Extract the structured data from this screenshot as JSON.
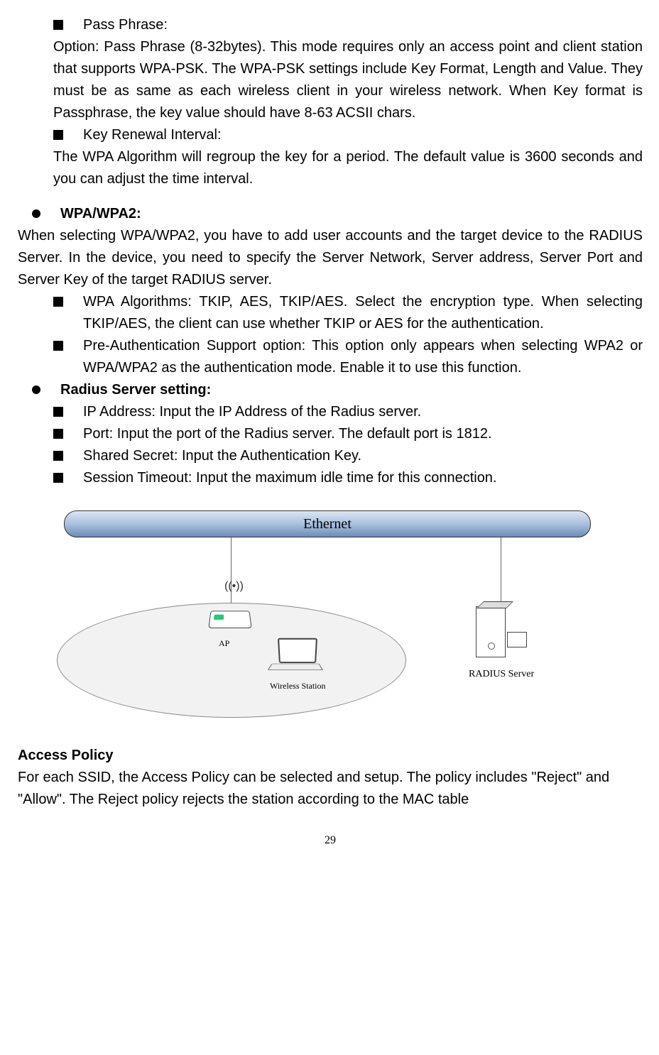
{
  "items": {
    "pass_phrase_title": "Pass Phrase:",
    "pass_phrase_body": "Option: Pass Phrase (8-32bytes). This mode requires only an access point and client station that supports WPA-PSK. The WPA-PSK settings include Key Format, Length and Value. They must be as same as each wireless client in your wireless network. When Key format is Passphrase, the key value should have 8-63 ACSII chars.",
    "key_renewal_title": "Key Renewal Interval:",
    "key_renewal_body": "The WPA Algorithm will regroup the key for a period. The default value is 3600 seconds and you can adjust the time interval.",
    "wpa_wpa2_title": "WPA/WPA2:",
    "wpa_wpa2_body": "When selecting WPA/WPA2, you have to add user accounts and the target device to the RADIUS Server. In the device, you need to specify the Server Network, Server address, Server Port and Server Key of the target RADIUS server.",
    "wpa_algo": "WPA Algorithms: TKIP, AES, TKIP/AES. Select the encryption type. When selecting TKIP/AES, the client can use whether TKIP or AES for the authentication.",
    "preauth": "Pre-Authentication Support option: This option only appears when selecting WPA2 or WPA/WPA2 as the authentication mode. Enable it to use this function.",
    "radius_title": "Radius Server setting:",
    "ip_addr": "IP Address: Input the IP Address of the Radius server.",
    "port": "Port: Input the port of the Radius server. The default port is 1812.",
    "shared_secret": "Shared Secret: Input the Authentication Key.",
    "session_timeout": "Session Timeout: Input the maximum idle time for this connection."
  },
  "diagram": {
    "ethernet": "Ethernet",
    "ap": "AP",
    "wireless_station": "Wireless Station",
    "radius_server": "RADIUS Server"
  },
  "access_policy": {
    "title": "Access Policy",
    "body": "For each SSID, the Access Policy can be selected and setup. The policy includes \"Reject\" and \"Allow\". The Reject policy rejects the station according to the MAC table"
  },
  "page_number": "29"
}
